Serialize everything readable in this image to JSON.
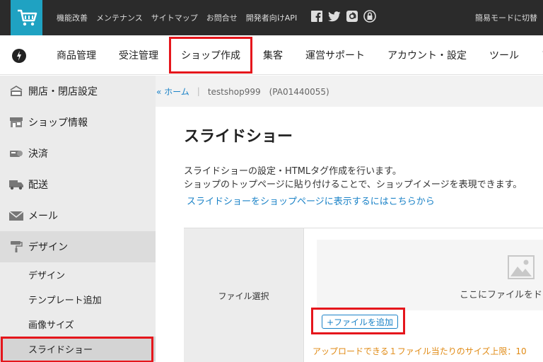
{
  "topbar": {
    "links": [
      "機能改善",
      "メンテナンス",
      "サイトマップ",
      "お問合せ",
      "開発者向けAPI"
    ],
    "social_icons": [
      "facebook-icon",
      "twitter-icon",
      "email-icon",
      "lock-icon"
    ],
    "mode_switch": "簡易モードに切替"
  },
  "mainnav": {
    "items": [
      "商品管理",
      "受注管理",
      "ショップ作成",
      "集客",
      "運営サポート",
      "アカウント・設定",
      "ツール",
      "ア"
    ],
    "highlighted_index": 2
  },
  "sidebar": {
    "items": [
      {
        "label": "開店・閉店設定",
        "icon": "open-sign-icon"
      },
      {
        "label": "ショップ情報",
        "icon": "shop-icon"
      },
      {
        "label": "決済",
        "icon": "payment-icon"
      },
      {
        "label": "配送",
        "icon": "truck-icon"
      },
      {
        "label": "メール",
        "icon": "mail-icon"
      },
      {
        "label": "デザイン",
        "icon": "paint-roller-icon"
      }
    ],
    "sub_items": [
      "デザイン",
      "テンプレート追加",
      "画像サイズ",
      "スライドショー"
    ]
  },
  "breadcrumb": {
    "home": "« ホーム",
    "separator": "|",
    "shop": "testshop999　(PA01440055)"
  },
  "main": {
    "title": "スライドショー",
    "desc_line1": "スライドショーの設定・HTMLタグ作成を行います。",
    "desc_line2": "ショップのトップページに貼り付けることで、ショップイメージを表現できます。",
    "link": "スライドショーをショップページに表示するにはこちらから",
    "form": {
      "label": "ファイル選択",
      "drop_text": "ここにファイルをド",
      "add_button": "+ファイルを追加",
      "upload_note": "アップロードできる１ファイル当たりのサイズ上限：10"
    }
  },
  "colors": {
    "topbar_bg": "#2b2b2b",
    "logo_bg": "#1fa2c2",
    "highlight_red": "#e5161c",
    "link_blue": "#1a82c7",
    "note_orange": "#e08a14"
  }
}
